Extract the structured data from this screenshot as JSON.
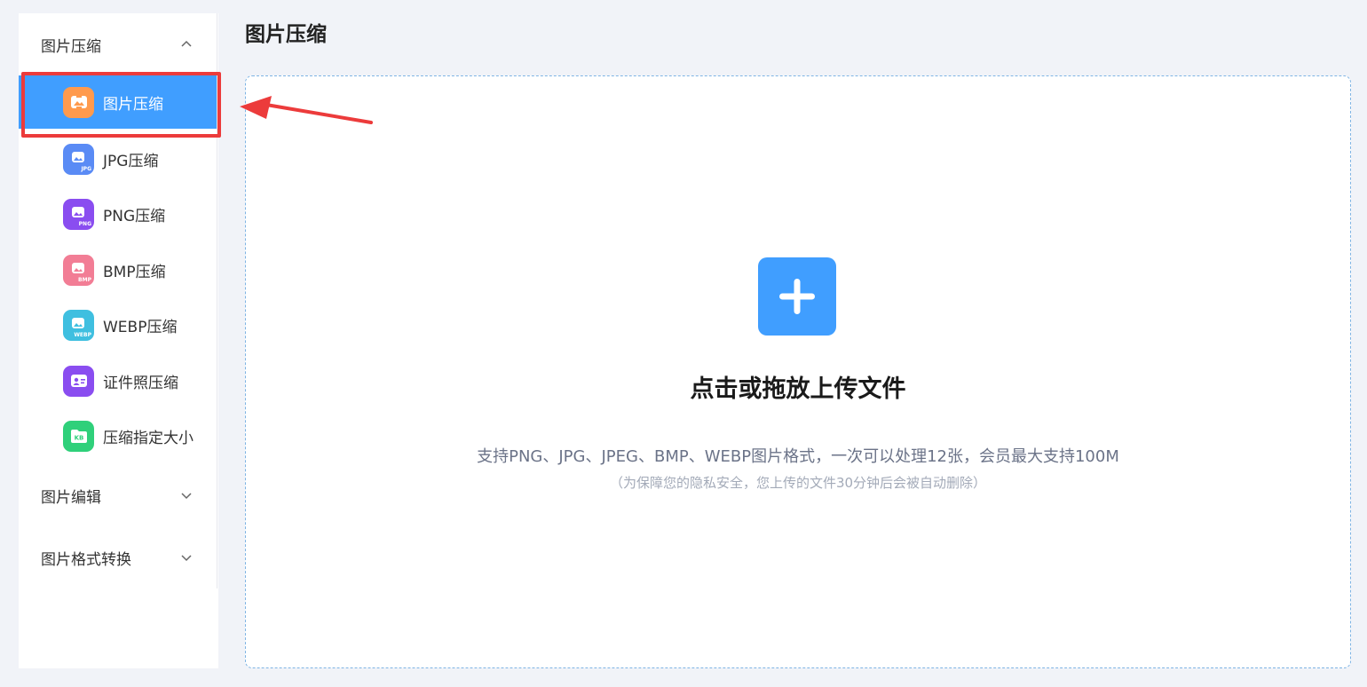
{
  "header": {
    "title": "图片压缩"
  },
  "sidebar": {
    "groups": [
      {
        "label": "图片压缩",
        "expanded": true
      },
      {
        "label": "图片编辑",
        "expanded": false
      },
      {
        "label": "图片格式转换",
        "expanded": false
      }
    ],
    "items": [
      {
        "label": "图片压缩",
        "icon": "image-compress-icon",
        "color": "#ff9a4d",
        "active": true
      },
      {
        "label": "JPG压缩",
        "icon": "jpg-icon",
        "color": "#5a8bf5",
        "tag": "JPG"
      },
      {
        "label": "PNG压缩",
        "icon": "png-icon",
        "color": "#8a4df0",
        "tag": "PNG"
      },
      {
        "label": "BMP压缩",
        "icon": "bmp-icon",
        "color": "#f27d95",
        "tag": "BMP"
      },
      {
        "label": "WEBP压缩",
        "icon": "webp-icon",
        "color": "#3fbfe0",
        "tag": "WEBP"
      },
      {
        "label": "证件照压缩",
        "icon": "id-photo-icon",
        "color": "#8a4df0"
      },
      {
        "label": "压缩指定大小",
        "icon": "kb-folder-icon",
        "color": "#2fd07a",
        "tag": "KB"
      }
    ]
  },
  "upload": {
    "title": "点击或拖放上传文件",
    "description": "支持PNG、JPG、JPEG、BMP、WEBP图片格式，一次可以处理12张，会员最大支持100M",
    "note": "（为保障您的隐私安全，您上传的文件30分钟后会被自动删除）"
  },
  "colors": {
    "accent": "#409eff",
    "highlight": "#ec3b3b"
  }
}
